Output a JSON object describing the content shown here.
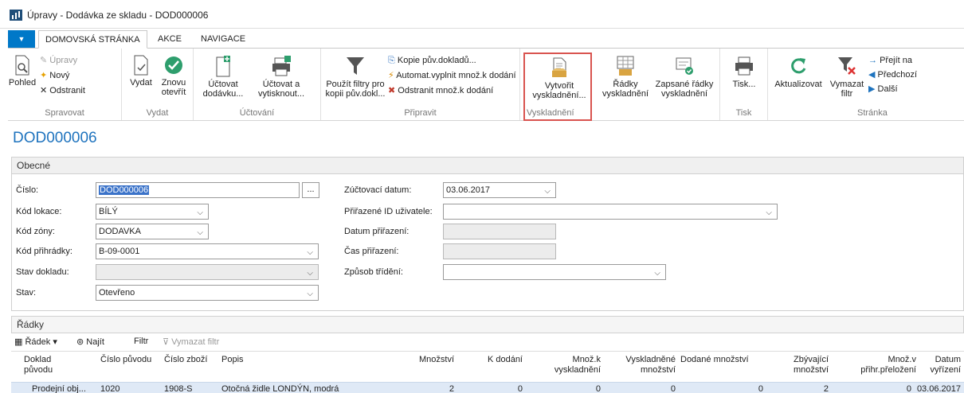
{
  "window": {
    "title": "Úpravy - Dodávka ze skladu - DOD000006"
  },
  "tabs": [
    {
      "label": "DOMOVSKÁ STRÁNKA"
    },
    {
      "label": "AKCE"
    },
    {
      "label": "NAVIGACE"
    }
  ],
  "ribbon": {
    "spravovat": {
      "label": "Spravovat",
      "pohled": "Pohled",
      "upravy": "Úpravy",
      "novy": "Nový",
      "odstranit": "Odstranit"
    },
    "vydat": {
      "label": "Vydat",
      "vydat": "Vydat",
      "znovu_1": "Znovu",
      "znovu_2": "otevřít"
    },
    "uctovani": {
      "label": "Účtování",
      "uctovat_1": "Účtovat",
      "uctovat_2": "dodávku...",
      "uctovat_tisk_1": "Účtovat a",
      "uctovat_tisk_2": "vytisknout..."
    },
    "pripravit": {
      "label": "Připravit",
      "filtry_1": "Použít filtry pro",
      "filtry_2": "kopii pův.dokl...",
      "kopie": "Kopie pův.dokladů...",
      "automat": "Automat.vyplnit množ.k dodání",
      "odstranit_mnoz": "Odstranit množ.k dodání"
    },
    "vyskladneni": {
      "label": "Vyskladnění",
      "vytvorit_1": "Vytvořit",
      "vytvorit_2": "vyskladnění...",
      "radky_1": "Řádky",
      "radky_2": "vyskladnění",
      "zapsane_1": "Zapsané řádky",
      "zapsane_2": "vyskladnění"
    },
    "tisk": {
      "label": "Tisk",
      "tisk": "Tisk..."
    },
    "stranka": {
      "label": "Stránka",
      "aktualizovat": "Aktualizovat",
      "vymazat_1": "Vymazat",
      "vymazat_2": "filtr",
      "prejit": "Přejít na",
      "predchozi": "Předchozí",
      "dalsi": "Další"
    }
  },
  "page_title": "DOD000006",
  "general": {
    "header": "Obecné",
    "cislo_label": "Číslo:",
    "cislo_value": "DOD000006",
    "ellipsis": "...",
    "kod_lokace_label": "Kód lokace:",
    "kod_lokace_value": "BÍLÝ",
    "kod_zony_label": "Kód zóny:",
    "kod_zony_value": "DODAVKA",
    "kod_prihradky_label": "Kód přihrádky:",
    "kod_prihradky_value": "B-09-0001",
    "stav_dokladu_label": "Stav dokladu:",
    "stav_dokladu_value": "",
    "stav_label": "Stav:",
    "stav_value": "Otevřeno",
    "zuctovaci_label": "Zúčtovací datum:",
    "zuctovaci_value": "03.06.2017",
    "prirazene_id_label": "Přiřazené ID uživatele:",
    "prirazene_id_value": "",
    "datum_prirazeni_label": "Datum přiřazení:",
    "cas_prirazeni_label": "Čas přiřazení:",
    "zpusob_trideni_label": "Způsob třídění:",
    "zpusob_trideni_value": ""
  },
  "lines": {
    "header": "Řádky",
    "toolbar": {
      "radek": "Řádek",
      "najit": "Najít",
      "filtr": "Filtr",
      "vymazat_filtr": "Vymazat filtr"
    },
    "columns": {
      "doklad_puvodu_1": "Doklad",
      "doklad_puvodu_2": "původu",
      "cislo_puvodu": "Číslo původu",
      "cislo_zbozi": "Číslo zboží",
      "popis": "Popis",
      "mnozstvi": "Množství",
      "k_dodani": "K dodání",
      "mnoz_k_vysk_1": "Množ.k",
      "mnoz_k_vysk_2": "vyskladnění",
      "vyskladnene_1": "Vyskladněné",
      "vyskladnene_2": "množství",
      "dodane": "Dodané množství",
      "zbyvajici_1": "Zbývající",
      "zbyvajici_2": "množství",
      "mnoz_v_1": "Množ.v",
      "mnoz_v_2": "přihr.přeložení",
      "datum_1": "Datum",
      "datum_2": "vyřízení"
    },
    "rows": [
      {
        "doklad_puvodu": "Prodejní obj...",
        "cislo_puvodu": "1020",
        "cislo_zbozi": "1908-S",
        "popis": "Otočná židle LONDÝN, modrá",
        "mnozstvi": "2",
        "k_dodani": "0",
        "mnoz_k_vysk": "0",
        "vyskladnene": "0",
        "dodane": "0",
        "zbyvajici": "2",
        "mnoz_v": "0",
        "datum": "03.06.2017"
      }
    ]
  },
  "colors": {
    "accent": "#1e73be",
    "menu_button": "#0078c8",
    "highlight": "#d9534f",
    "row_selected": "#dfe9f6"
  }
}
